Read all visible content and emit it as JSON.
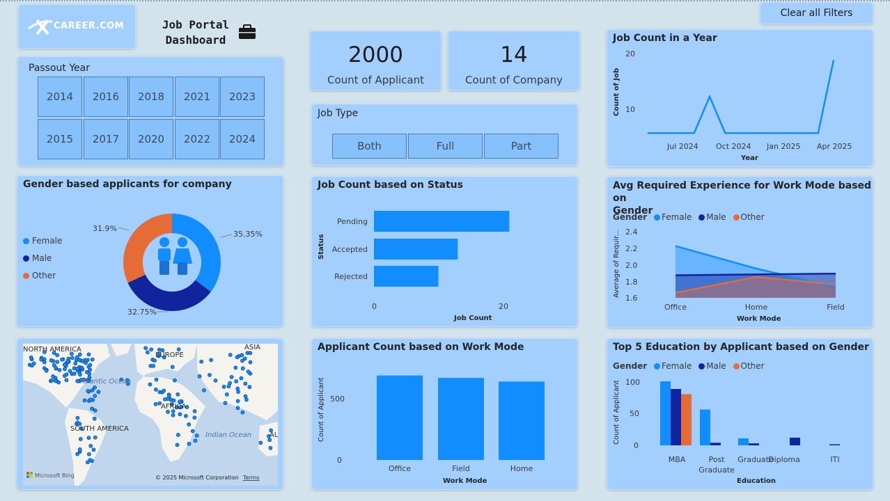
{
  "header": {
    "logo_text": "CAREER.COM",
    "title_line1": "Job Portal",
    "title_line2": "Dashboard",
    "clear_filters": "Clear all Filters"
  },
  "kpis": [
    {
      "value": "2000",
      "label": "Count of Applicant"
    },
    {
      "value": "14",
      "label": "Count of Company"
    }
  ],
  "passout": {
    "title": "Passout Year",
    "years": [
      "2014",
      "2016",
      "2018",
      "2021",
      "2023",
      "2015",
      "2017",
      "2020",
      "2022",
      "2024"
    ]
  },
  "job_type": {
    "title": "Job Type",
    "options": [
      "Both",
      "Full",
      "Part"
    ]
  },
  "job_count_year": {
    "title": "Job Count in a Year",
    "xlabel": "Year",
    "ylabel": "Count of Job",
    "yticks": [
      "20",
      "10"
    ],
    "xticks": [
      "Jul 2024",
      "Oct 2024",
      "Jan 2025",
      "Apr 2025"
    ]
  },
  "gender_company": {
    "title": "Gender based applicants for company",
    "legend": [
      "Female",
      "Male",
      "Other"
    ],
    "labels": [
      "35.35%",
      "32.75%",
      "31.9%"
    ]
  },
  "status_chart": {
    "title": "Job Count based on Status",
    "ylabel": "Status",
    "xlabel": "Job Count",
    "xticks": [
      "0",
      "20"
    ]
  },
  "avg_exp": {
    "title_line1": "Avg Required Experience for Work Mode based on",
    "title_line2": "Gender",
    "legend_title": "Gender",
    "legend": [
      "Female",
      "Male",
      "Other"
    ],
    "ylabel": "Average of Requir...",
    "xlabel": "Work Mode",
    "yticks": [
      "2.4",
      "2.2",
      "2.0",
      "1.8",
      "1.6"
    ]
  },
  "map": {
    "labels": [
      "NORTH AMERICA",
      "EUROPE",
      "ASIA",
      "Atlantic Ocean",
      "AFRICA",
      "SOUTH AMERICA",
      "Indian Ocean",
      "AU"
    ],
    "bing": "Microsoft Bing",
    "copyright": "© 2025 Microsoft Corporation",
    "terms": "Terms"
  },
  "work_mode_chart": {
    "title": "Applicant Count based on Work Mode",
    "ylabel": "Count of Applicant",
    "xlabel": "Work Mode",
    "yticks": [
      "500",
      "0"
    ]
  },
  "education_chart": {
    "title": "Top 5 Education by Applicant based on Gender",
    "legend_title": "Gender",
    "legend": [
      "Female",
      "Male",
      "Other"
    ],
    "ylabel": "Count of Applicant",
    "xlabel": "Education",
    "yticks": [
      "100",
      "50",
      "0"
    ],
    "post_graduate_line1": "Post",
    "post_graduate_line2": "Graduate"
  },
  "colors": {
    "female": "#118dff",
    "male": "#12239e",
    "other": "#e66c37",
    "card": "#a2cffd"
  },
  "chart_data": [
    {
      "type": "line",
      "title": "Job Count in a Year",
      "xlabel": "Year",
      "ylabel": "Count of Job",
      "x": [
        "2024-05",
        "2024-06",
        "2024-07",
        "2024-08",
        "2024-09",
        "2024-10",
        "2024-11",
        "2024-12",
        "2025-01",
        "2025-02",
        "2025-03",
        "2025-04",
        "2025-05"
      ],
      "values": [
        1,
        1,
        1,
        1,
        10,
        1,
        1,
        1,
        1,
        1,
        1,
        1,
        19
      ],
      "ylim": [
        0,
        22
      ]
    },
    {
      "type": "pie",
      "title": "Gender based applicants for company",
      "categories": [
        "Female",
        "Male",
        "Other"
      ],
      "values": [
        35.35,
        32.75,
        31.9
      ]
    },
    {
      "type": "bar",
      "title": "Job Count based on Status",
      "categories": [
        "Pending",
        "Accepted",
        "Rejected"
      ],
      "values": [
        21,
        13,
        10
      ],
      "xlim": [
        0,
        25
      ]
    },
    {
      "type": "area",
      "title": "Avg Required Experience for Work Mode based on Gender",
      "categories": [
        "Office",
        "Home",
        "Field"
      ],
      "series": [
        {
          "name": "Female",
          "values": [
            2.22,
            1.95,
            1.73
          ]
        },
        {
          "name": "Male",
          "values": [
            1.87,
            1.88,
            1.89
          ]
        },
        {
          "name": "Other",
          "values": [
            1.66,
            1.85,
            1.76
          ]
        }
      ],
      "ylim": [
        1.6,
        2.4
      ]
    },
    {
      "type": "bar",
      "title": "Applicant Count based on Work Mode",
      "categories": [
        "Office",
        "Field",
        "Home"
      ],
      "values": [
        690,
        670,
        640
      ],
      "ylim": [
        0,
        750
      ]
    },
    {
      "type": "bar",
      "title": "Top 5 Education by Applicant based on Gender",
      "categories": [
        "MBA",
        "Post Graduate",
        "Graduate",
        "Diploma",
        "ITI"
      ],
      "series": [
        {
          "name": "Female",
          "values": [
            100,
            56,
            11,
            0,
            0
          ]
        },
        {
          "name": "Male",
          "values": [
            88,
            4,
            3,
            12,
            1
          ]
        },
        {
          "name": "Other",
          "values": [
            80,
            0,
            0,
            0,
            0
          ]
        }
      ],
      "ylim": [
        0,
        110
      ]
    }
  ]
}
